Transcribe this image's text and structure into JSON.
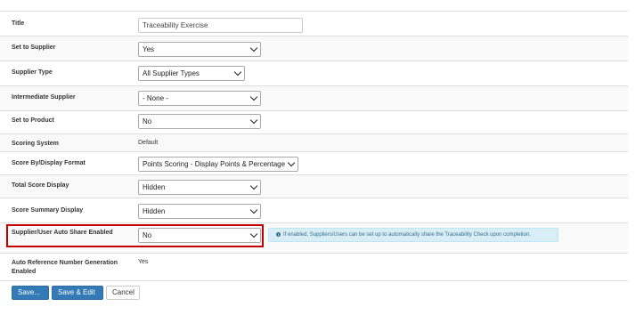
{
  "fields": {
    "title": {
      "label": "Title",
      "value": "Traceability Exercise"
    },
    "set_to_supplier": {
      "label": "Set to Supplier",
      "value": "Yes"
    },
    "supplier_type": {
      "label": "Supplier Type",
      "value": "All Supplier Types"
    },
    "intermediate_supplier": {
      "label": "Intermediate Supplier",
      "value": "- None -"
    },
    "set_to_product": {
      "label": "Set to Product",
      "value": "No"
    },
    "scoring_system": {
      "label": "Scoring System",
      "value": "Default"
    },
    "score_by_display_format": {
      "label": "Score By/Display Format",
      "value": "Points Scoring - Display Points & Percentage"
    },
    "total_score_display": {
      "label": "Total Score Display",
      "value": "Hidden"
    },
    "score_summary_display": {
      "label": "Score Summary Display",
      "value": "Hidden"
    },
    "auto_share": {
      "label": "Supplier/User Auto Share Enabled",
      "value": "No",
      "info": "If enabled, Suppliers/Users can be set up to automatically share the Traceability Check upon completion."
    },
    "auto_reference": {
      "label_line1": "Auto Reference Number Generation",
      "label_line2": "Enabled",
      "value": "Yes"
    }
  },
  "buttons": {
    "save": "Save...",
    "save_edit": "Save & Edit",
    "cancel": "Cancel"
  },
  "colors": {
    "primary": "#337ab7",
    "highlight_border": "#c00000",
    "info_bg": "#d9edf7",
    "info_text": "#31708f"
  }
}
